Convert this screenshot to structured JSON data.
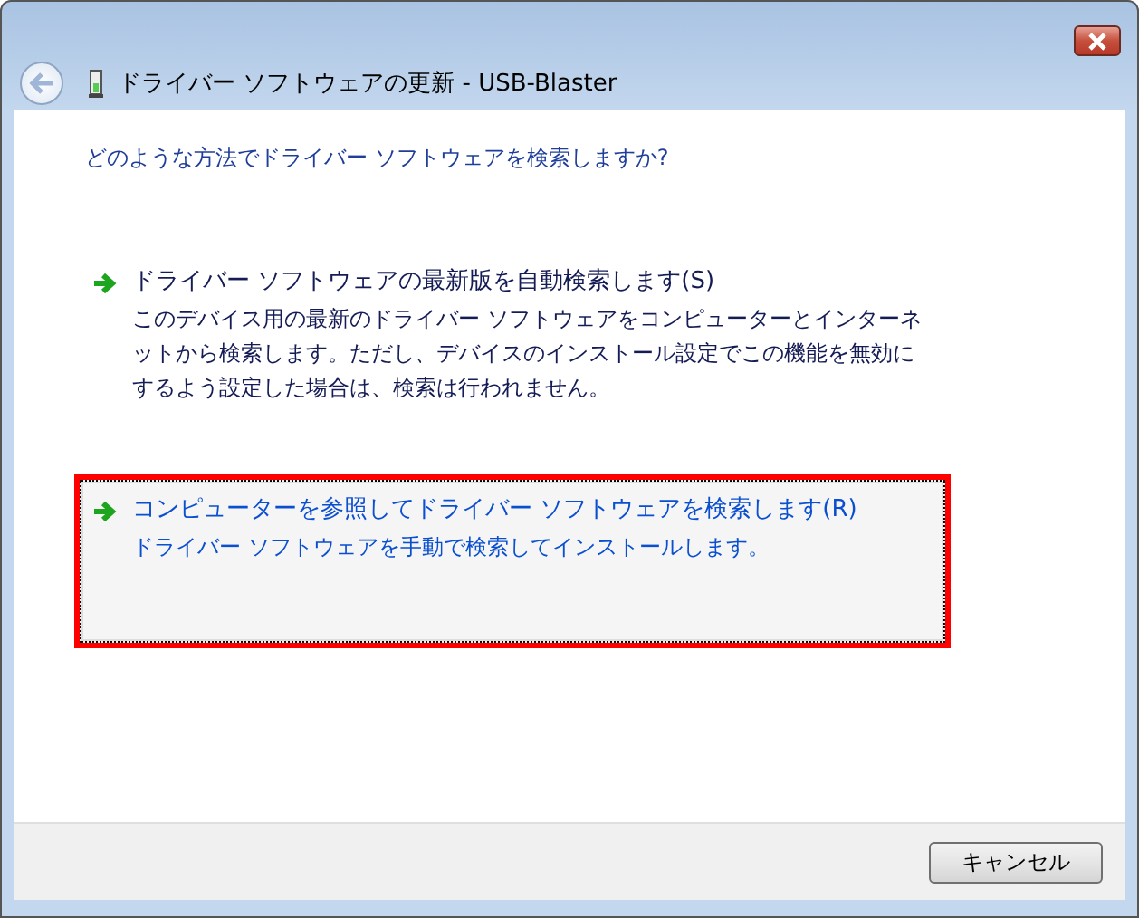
{
  "window": {
    "title": "ドライバー ソフトウェアの更新 - USB-Blaster"
  },
  "question": "どのような方法でドライバー ソフトウェアを検索しますか?",
  "options": [
    {
      "title": "ドライバー ソフトウェアの最新版を自動検索します(S)",
      "description": "このデバイス用の最新のドライバー ソフトウェアをコンピューターとインターネットから検索します。ただし、デバイスのインストール設定でこの機能を無効にするよう設定した場合は、検索は行われません。",
      "selected": false,
      "annotated": false
    },
    {
      "title": "コンピューターを参照してドライバー ソフトウェアを検索します(R)",
      "description": "ドライバー ソフトウェアを手動で検索してインストールします。",
      "selected": true,
      "annotated": true
    }
  ],
  "buttons": [
    "キャンセル"
  ]
}
